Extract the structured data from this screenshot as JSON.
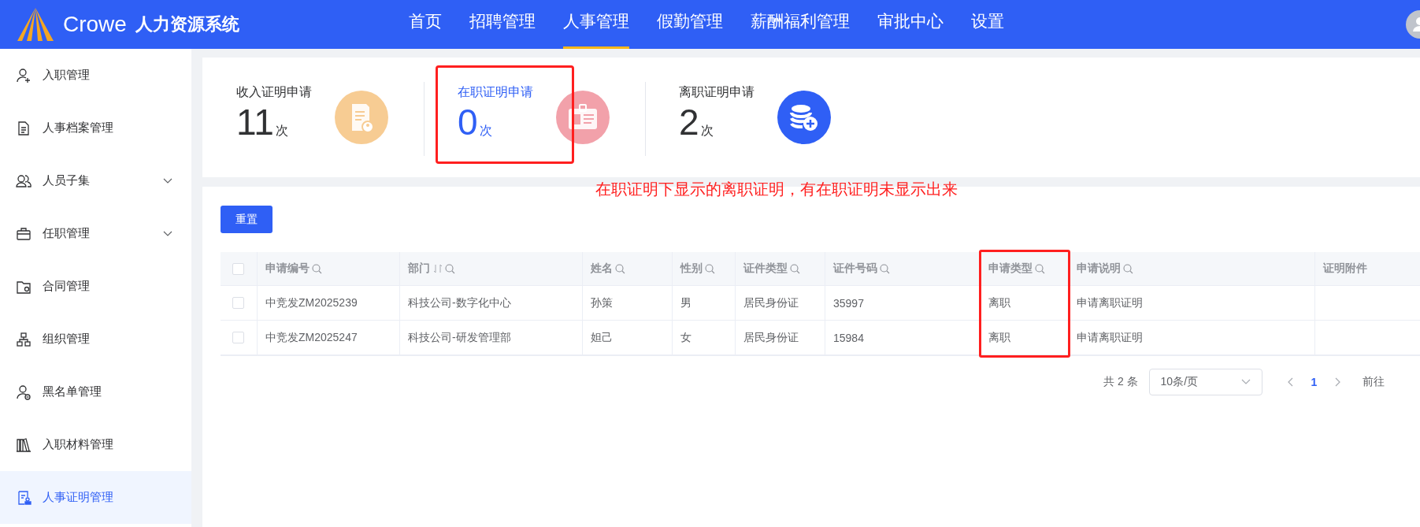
{
  "header": {
    "brand": "Crowe",
    "system_name": "人力资源系统",
    "nav": [
      {
        "label": "首页",
        "selected": false
      },
      {
        "label": "招聘管理",
        "selected": false
      },
      {
        "label": "人事管理",
        "selected": true
      },
      {
        "label": "假勤管理",
        "selected": false
      },
      {
        "label": "薪酬福利管理",
        "selected": false
      },
      {
        "label": "审批中心",
        "selected": false
      },
      {
        "label": "设置",
        "selected": false
      }
    ]
  },
  "sidebar": {
    "items": [
      {
        "label": "入职管理",
        "expandable": false,
        "selected": false
      },
      {
        "label": "人事档案管理",
        "expandable": false,
        "selected": false
      },
      {
        "label": "人员子集",
        "expandable": true,
        "selected": false
      },
      {
        "label": "任职管理",
        "expandable": true,
        "selected": false
      },
      {
        "label": "合同管理",
        "expandable": false,
        "selected": false
      },
      {
        "label": "组织管理",
        "expandable": false,
        "selected": false
      },
      {
        "label": "黑名单管理",
        "expandable": false,
        "selected": false
      },
      {
        "label": "入职材料管理",
        "expandable": false,
        "selected": false
      },
      {
        "label": "人事证明管理",
        "expandable": false,
        "selected": true
      }
    ]
  },
  "stats": [
    {
      "label": "收入证明申请",
      "count": "11",
      "unit": "次",
      "color": "#f7cc93",
      "selected": false,
      "highlighted": false
    },
    {
      "label": "在职证明申请",
      "count": "0",
      "unit": "次",
      "color": "#f2a1aa",
      "selected": true,
      "highlighted": true
    },
    {
      "label": "离职证明申请",
      "count": "2",
      "unit": "次",
      "color": "#2f5ff5",
      "selected": false,
      "highlighted": false
    }
  ],
  "annotation": "在职证明下显示的离职证明，有在职证明未显示出来",
  "reset_button": "重置",
  "table": {
    "select_all": {
      "checked": false
    },
    "columns": [
      {
        "label": "申请编号",
        "sortable": false,
        "filterable": true,
        "highlighted": false
      },
      {
        "label": "部门",
        "sortable": true,
        "filterable": true,
        "highlighted": false
      },
      {
        "label": "姓名",
        "sortable": false,
        "filterable": true,
        "highlighted": false
      },
      {
        "label": "性别",
        "sortable": false,
        "filterable": true,
        "highlighted": false
      },
      {
        "label": "证件类型",
        "sortable": false,
        "filterable": true,
        "highlighted": false
      },
      {
        "label": "证件号码",
        "sortable": false,
        "filterable": true,
        "highlighted": false
      },
      {
        "label": "申请类型",
        "sortable": false,
        "filterable": true,
        "highlighted": true
      },
      {
        "label": "申请说明",
        "sortable": false,
        "filterable": true,
        "highlighted": false
      },
      {
        "label": "证明附件",
        "sortable": false,
        "filterable": false,
        "highlighted": false
      }
    ],
    "rows": [
      {
        "checked": false,
        "cells": [
          "中竞发ZM2025239",
          "科技公司-数字化中心",
          "孙策",
          "男",
          "居民身份证",
          "35997",
          "离职",
          "申请离职证明",
          ""
        ]
      },
      {
        "checked": false,
        "cells": [
          "中竞发ZM2025247",
          "科技公司-研发管理部",
          "妲己",
          "女",
          "居民身份证",
          "15984",
          "离职",
          "申请离职证明",
          ""
        ]
      }
    ]
  },
  "pagination": {
    "total": "共 2 条",
    "page_size": "10条/页",
    "pages": [
      {
        "label": "1",
        "selected": true
      }
    ],
    "goto_label": "前往"
  }
}
